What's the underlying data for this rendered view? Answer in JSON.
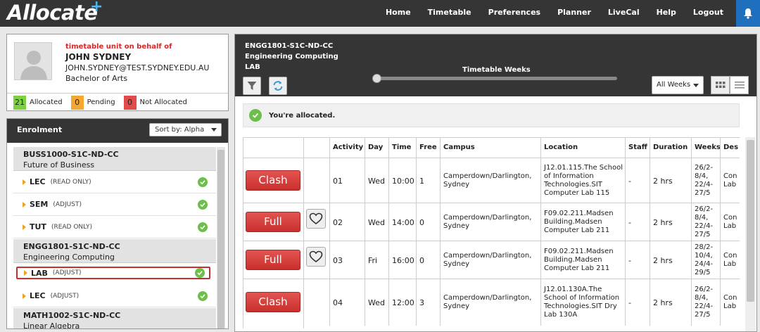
{
  "app": {
    "logo": "Allocate",
    "logo_plus": "+"
  },
  "nav": [
    "Home",
    "Timetable",
    "Preferences",
    "Planner",
    "LiveCal",
    "Help",
    "Logout"
  ],
  "profile": {
    "on_behalf": "timetable unit on behalf of",
    "name": "JOHN SYDNEY",
    "email": "JOHN.SYDNEY@TEST.SYDNEY.EDU.AU",
    "degree": "Bachelor of Arts",
    "counts": [
      {
        "value": "21",
        "label": "Allocated",
        "color": "#7bd23e"
      },
      {
        "value": "0",
        "label": "Pending",
        "color": "#f2a833"
      },
      {
        "value": "0",
        "label": "Not Allocated",
        "color": "#e34a4a"
      }
    ]
  },
  "enrolment": {
    "title": "Enrolment",
    "sort_label": "Sort by: Alpha",
    "units": [
      {
        "code": "BUSS1000-S1C-ND-CC",
        "name": "Future of Business",
        "activities": [
          {
            "type": "LEC",
            "mode": "(READ ONLY)"
          },
          {
            "type": "SEM",
            "mode": "(ADJUST)"
          },
          {
            "type": "TUT",
            "mode": "(READ ONLY)"
          }
        ]
      },
      {
        "code": "ENGG1801-S1C-ND-CC",
        "name": "Engineering Computing",
        "activities": [
          {
            "type": "LAB",
            "mode": "(ADJUST)"
          },
          {
            "type": "LEC",
            "mode": "(ADJUST)"
          }
        ]
      },
      {
        "code": "MATH1002-S1C-ND-CC",
        "name": "Linear Algebra",
        "activities": []
      }
    ]
  },
  "panel": {
    "line1": "ENGG1801-S1C-ND-CC",
    "line2": "Engineering Computing",
    "line3": "LAB",
    "timetable_weeks": "Timetable Weeks",
    "weeks_select": "All Weeks",
    "alloc_message": "You're allocated."
  },
  "table": {
    "headers": [
      "",
      "",
      "Activity",
      "Day",
      "Time",
      "Free",
      "Campus",
      "Location",
      "Staff",
      "Duration",
      "Weeks",
      "Des"
    ],
    "rows": [
      {
        "action": "Clash",
        "heart": false,
        "activity": "01",
        "day": "Wed",
        "time": "10:00",
        "free": "1",
        "campus": "Camperdown/Darlington, Sydney",
        "location": "J12.01.115.The School of Information Technologies.SIT Computer Lab 115",
        "staff": "-",
        "duration": "2 hrs",
        "weeks": "26/2-8/4, 22/4-27/5",
        "des": "Con Lab"
      },
      {
        "action": "Full",
        "heart": true,
        "activity": "02",
        "day": "Wed",
        "time": "14:00",
        "free": "0",
        "campus": "Camperdown/Darlington, Sydney",
        "location": "F09.02.211.Madsen Building.Madsen Computer Lab 211",
        "staff": "-",
        "duration": "2 hrs",
        "weeks": "26/2-8/4, 22/4-27/5",
        "des": "Con Lab"
      },
      {
        "action": "Full",
        "heart": true,
        "activity": "03",
        "day": "Fri",
        "time": "16:00",
        "free": "0",
        "campus": "Camperdown/Darlington, Sydney",
        "location": "F09.02.211.Madsen Building.Madsen Computer Lab 211",
        "staff": "-",
        "duration": "2 hrs",
        "weeks": "28/2-10/4, 24/4-29/5",
        "des": "Con Lab"
      },
      {
        "action": "Clash",
        "heart": false,
        "activity": "04",
        "day": "Wed",
        "time": "12:00",
        "free": "3",
        "campus": "Camperdown/Darlington, Sydney",
        "location": "J12.01.130A.The School of Information Technologies.SIT Dry Lab 130A",
        "staff": "-",
        "duration": "2 hrs",
        "weeks": "26/2-8/4, 22/4-27/5",
        "des": "Con Lab"
      }
    ]
  },
  "colors": {
    "topbar": "#353535",
    "accent": "#1f6fbf",
    "danger": "#d7403e",
    "ok": "#6cc04a"
  },
  "icons": [
    "bell-icon",
    "filter-icon",
    "refresh-icon",
    "grid-view-icon",
    "list-view-icon",
    "heart-icon",
    "check-icon",
    "user-avatar-icon"
  ]
}
